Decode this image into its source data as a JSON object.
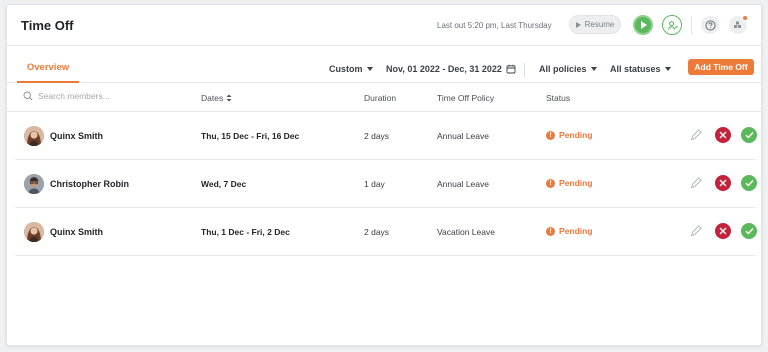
{
  "header": {
    "title": "Time Off",
    "last_out": "Last out 5:20 pm, Last Thursday",
    "resume_label": "Resume"
  },
  "tabs": [
    {
      "label": "Overview",
      "active": true
    }
  ],
  "filters": {
    "range_type": "Custom",
    "date_range": "Nov, 01 2022 - Dec, 31 2022",
    "policies": "All policies",
    "statuses": "All statuses"
  },
  "add_button_label": "Add Time Off",
  "table": {
    "search_placeholder": "Search members...",
    "columns": [
      "Dates",
      "Duration",
      "Time Off Policy",
      "Status"
    ],
    "rows": [
      {
        "member": "Quinx Smith",
        "dates": "Thu, 15 Dec - Fri, 16 Dec",
        "duration": "2 days",
        "policy": "Annual Leave",
        "status": "Pending"
      },
      {
        "member": "Christopher Robin",
        "dates": "Wed, 7 Dec",
        "duration": "1 day",
        "policy": "Annual Leave",
        "status": "Pending"
      },
      {
        "member": "Quinx Smith",
        "dates": "Thu, 1 Dec - Fri, 2 Dec",
        "duration": "2 days",
        "policy": "Vacation Leave",
        "status": "Pending"
      }
    ]
  },
  "colors": {
    "accent": "#ee7a3a",
    "approve": "#5cb85c",
    "reject": "#c3223b"
  },
  "icons": [
    "play-icon",
    "assign-user-icon",
    "help-icon",
    "apps-icon",
    "calendar-icon",
    "search-icon",
    "sort-icon",
    "edit-icon",
    "reject-icon",
    "approve-icon"
  ]
}
